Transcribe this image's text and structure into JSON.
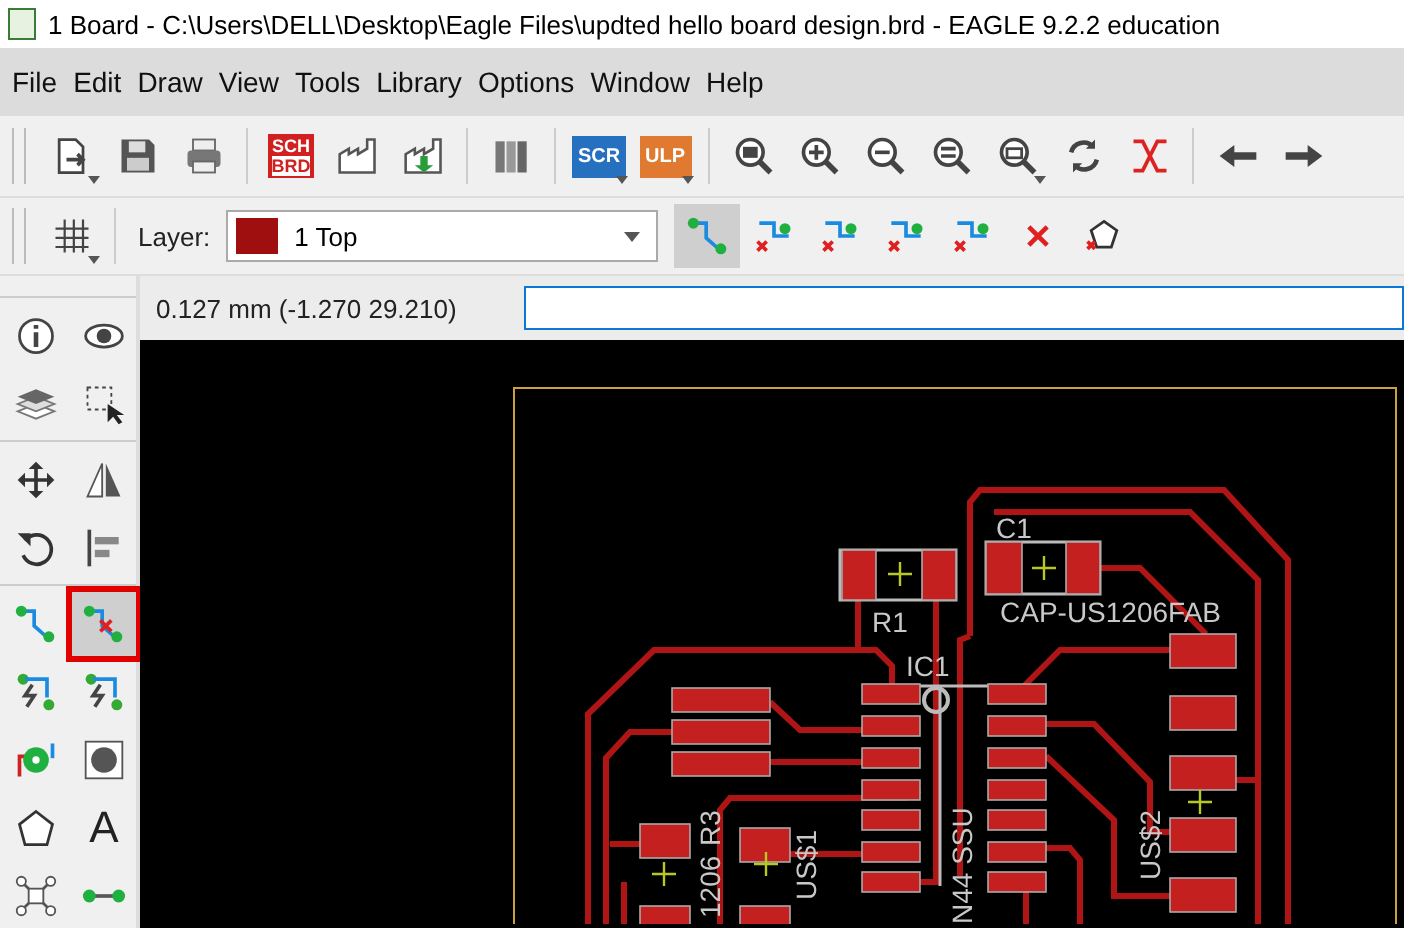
{
  "window": {
    "title": "1 Board - C:\\Users\\DELL\\Desktop\\Eagle Files\\updted hello board design.brd - EAGLE 9.2.2 education"
  },
  "menu": [
    "File",
    "Edit",
    "Draw",
    "View",
    "Tools",
    "Library",
    "Options",
    "Window",
    "Help"
  ],
  "main_toolbar": [
    [
      {
        "kind": "open",
        "menu": true
      },
      {
        "kind": "save",
        "menu": false
      },
      {
        "kind": "print",
        "menu": false
      }
    ],
    [
      {
        "kind": "sch-brd",
        "text": "SCH",
        "text2": "BRD",
        "menu": false
      },
      {
        "kind": "cam",
        "menu": false
      },
      {
        "kind": "cam-export",
        "menu": false
      }
    ],
    [
      {
        "kind": "library",
        "menu": false
      }
    ],
    [
      {
        "kind": "script",
        "text": "SCR",
        "menu": true
      },
      {
        "kind": "ulp",
        "text": "ULP",
        "menu": true
      }
    ],
    [
      {
        "kind": "zoom-fit",
        "menu": false
      },
      {
        "kind": "zoom-in",
        "menu": false
      },
      {
        "kind": "zoom-out",
        "menu": false
      },
      {
        "kind": "zoom-select",
        "menu": false
      },
      {
        "kind": "zoom-last",
        "menu": true
      },
      {
        "kind": "redraw",
        "menu": false
      },
      {
        "kind": "ratsnest",
        "menu": false
      }
    ],
    [
      {
        "kind": "undo",
        "menu": false
      },
      {
        "kind": "redo",
        "menu": false
      }
    ]
  ],
  "layer_toolbar": {
    "grid_menu": true,
    "label": "Layer:",
    "layer": "1 Top",
    "tools": [
      {
        "kind": "route",
        "selected": true
      },
      {
        "kind": "ripup-all",
        "selected": false
      },
      {
        "kind": "ripup-one",
        "selected": false
      },
      {
        "kind": "ripup-signal",
        "selected": false
      },
      {
        "kind": "ripup-polygon",
        "selected": false
      },
      {
        "kind": "delete",
        "selected": false
      },
      {
        "kind": "poly-ripup",
        "selected": false
      }
    ]
  },
  "coordinates": "0.127 mm (-1.270 29.210)",
  "palette": [
    [
      {
        "kind": "info",
        "selected": false
      },
      {
        "kind": "eye",
        "selected": false
      },
      {
        "kind": "layers",
        "selected": false
      },
      {
        "kind": "group",
        "selected": false
      }
    ],
    [
      {
        "kind": "move",
        "selected": false
      },
      {
        "kind": "mirror",
        "selected": false
      },
      {
        "kind": "rotate",
        "selected": false
      },
      {
        "kind": "align",
        "selected": false
      }
    ],
    [
      {
        "kind": "route",
        "selected": false
      },
      {
        "kind": "ripup",
        "selected": true
      },
      {
        "kind": "autoroute",
        "selected": false
      },
      {
        "kind": "fanout",
        "selected": false
      },
      {
        "kind": "via",
        "selected": false
      },
      {
        "kind": "hole",
        "selected": false
      },
      {
        "kind": "polygon",
        "selected": false
      },
      {
        "kind": "text",
        "glyph": "A",
        "selected": false
      },
      {
        "kind": "node",
        "selected": false
      },
      {
        "kind": "wire",
        "selected": false
      }
    ]
  ],
  "board_labels": [
    "C1",
    "R1",
    "CAP-US1206FAB",
    "IC1",
    "US$2",
    "US$1",
    "R3",
    "1206",
    "N44 SSU"
  ]
}
